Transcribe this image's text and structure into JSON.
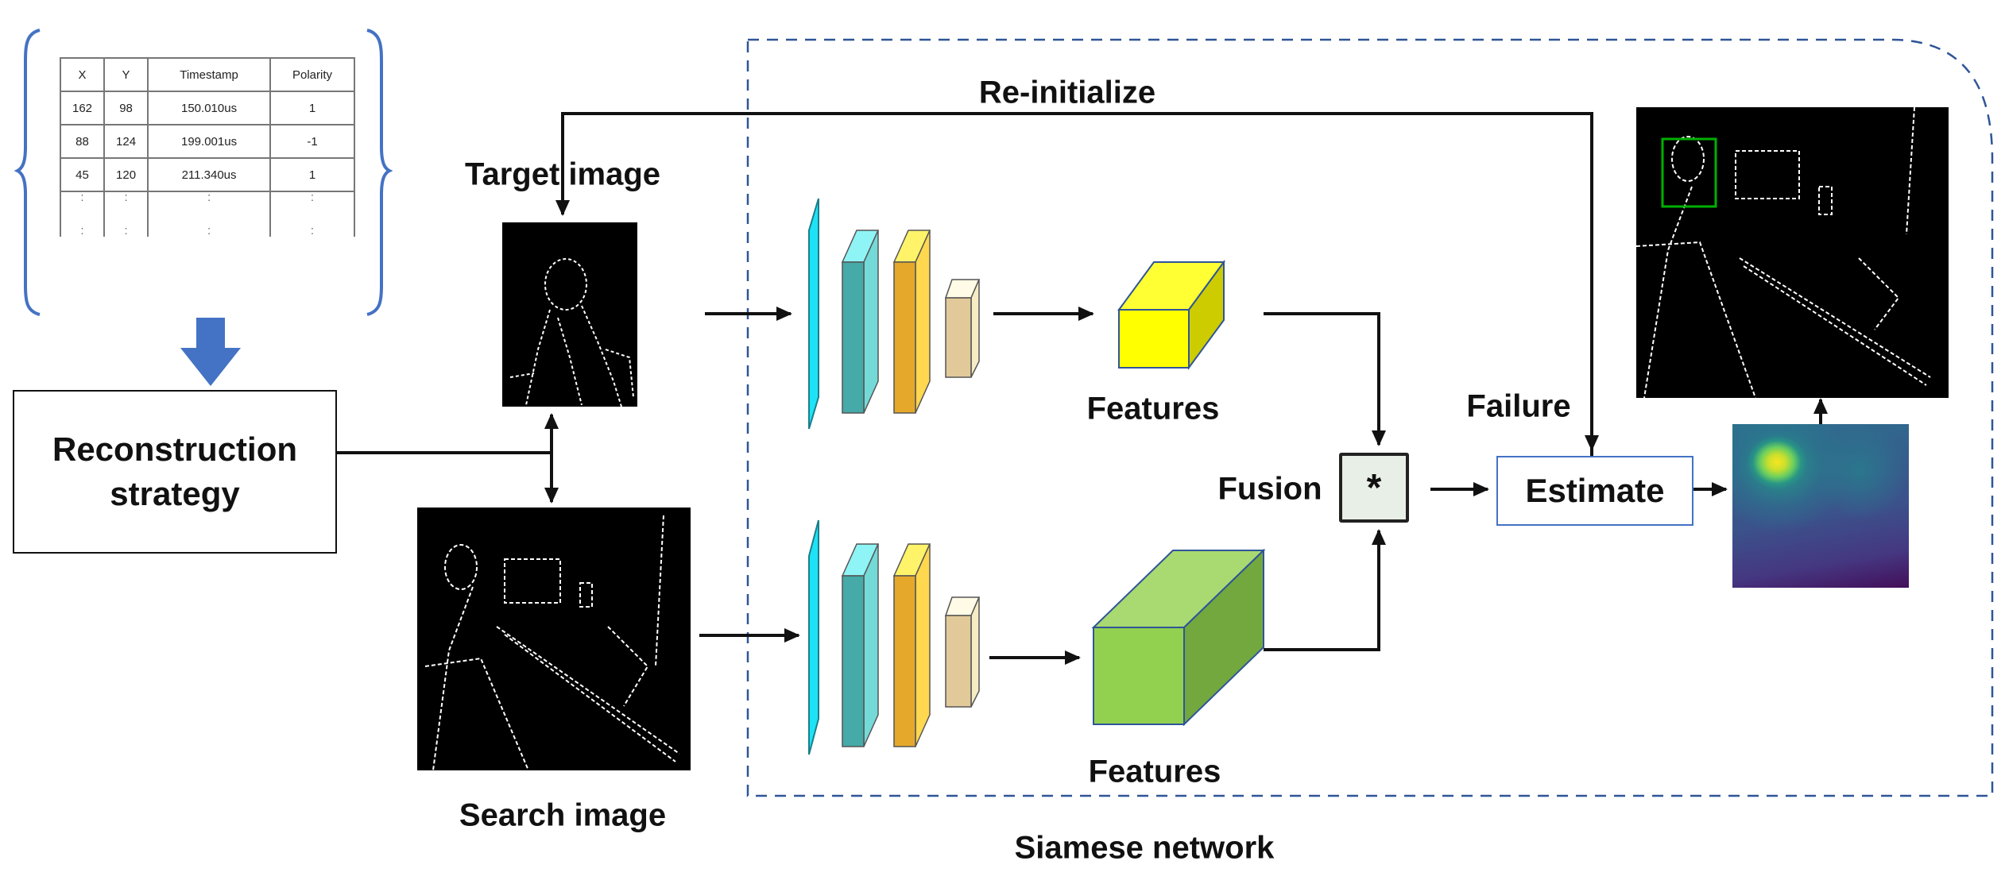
{
  "diagram": {
    "event_table": {
      "columns": [
        "X",
        "Y",
        "Timestamp",
        "Polarity"
      ],
      "rows": [
        [
          "162",
          "98",
          "150.010us",
          "1"
        ],
        [
          "88",
          "124",
          "199.001us",
          "-1"
        ],
        [
          "45",
          "120",
          "211.340us",
          "1"
        ]
      ],
      "ellipsis": ":"
    },
    "reconstruction": {
      "line1": "Reconstruction",
      "line2": "strategy"
    },
    "labels": {
      "target_image": "Target image",
      "search_image": "Search image",
      "reinitialize": "Re-initialize",
      "features_top": "Features",
      "features_bottom": "Features",
      "fusion": "Fusion",
      "fusion_operator": "*",
      "estimate": "Estimate",
      "failure": "Failure",
      "siamese_network": "Siamese network"
    },
    "colors": {
      "arrow_blue": "#4472c4",
      "dashed_border": "#2f5597",
      "layer_cyan": "#1ee3f7",
      "layer_teal": "#45aaa8",
      "layer_orange": "#e5a82a",
      "layer_beige": "#e2c99a",
      "feature_yellow": "#ffff00",
      "feature_green": "#92d050",
      "bbox_green": "#00b000"
    }
  }
}
